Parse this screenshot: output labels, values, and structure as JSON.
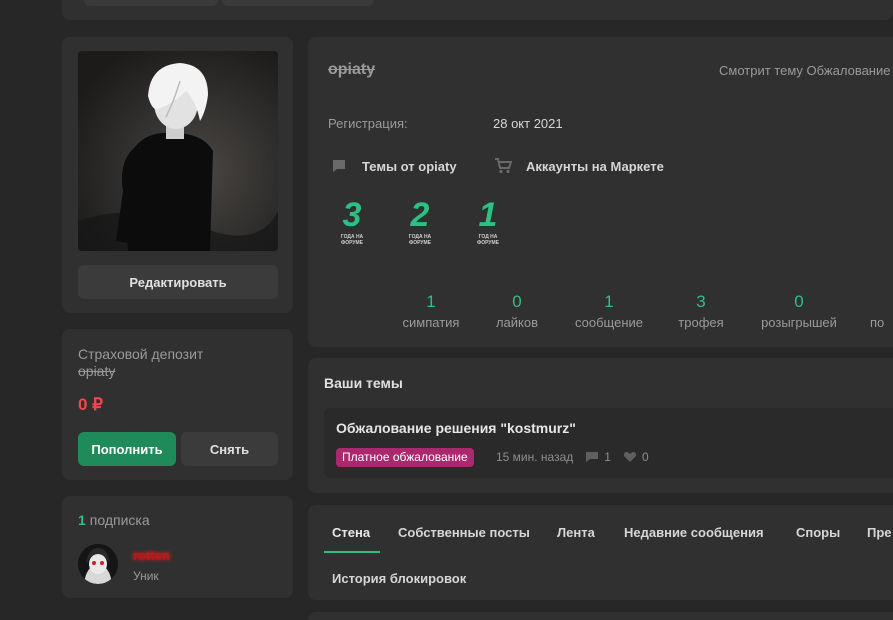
{
  "profile": {
    "username": "opiaty",
    "viewing_status": "Смотрит тему Обжалование",
    "registration_label": "Регистрация:",
    "registration_date": "28 окт 2021",
    "edit_button": "Редактировать",
    "links": [
      {
        "label": "Темы от opiaty",
        "icon": "chat-bubble-icon"
      },
      {
        "label": "Аккаунты на Маркете",
        "icon": "cart-icon"
      }
    ],
    "trophies": [
      {
        "number": "3",
        "caption_line1": "ГОДА НА",
        "caption_line2": "ФОРУМЕ"
      },
      {
        "number": "2",
        "caption_line1": "ГОДА НА",
        "caption_line2": "ФОРУМЕ"
      },
      {
        "number": "1",
        "caption_line1": "ГОД НА",
        "caption_line2": "ФОРУМЕ"
      }
    ],
    "stats": [
      {
        "value": "1",
        "label": "симпатия"
      },
      {
        "value": "0",
        "label": "лайков"
      },
      {
        "value": "1",
        "label": "сообщение"
      },
      {
        "value": "3",
        "label": "трофея"
      },
      {
        "value": "0",
        "label": "розыгрышей"
      },
      {
        "value": "",
        "label": "по"
      }
    ]
  },
  "deposit": {
    "title": "Страховой депозит",
    "name": "opiaty",
    "amount": "0 ₽",
    "topup_button": "Пополнить",
    "withdraw_button": "Снять"
  },
  "subscriptions": {
    "count": "1",
    "label": "подписка",
    "items": [
      {
        "name": "rotten",
        "role": "Уник"
      }
    ]
  },
  "topics": {
    "title": "Ваши темы",
    "items": [
      {
        "title": "Обжалование решения \"kostmurz\"",
        "badge": "Платное обжалование",
        "time": "15 мин. назад",
        "replies": "1",
        "likes": "0"
      }
    ]
  },
  "tabs": {
    "row1": [
      "Стена",
      "Собственные посты",
      "Лента",
      "Недавние сообщения",
      "Споры",
      "Пре"
    ],
    "row2": [
      "История блокировок"
    ],
    "active": "Стена"
  },
  "colors": {
    "accent_green": "#2fbf84",
    "primary_button": "#1f8a5a",
    "danger_red": "#f0494a",
    "badge_magenta": "#a9286e",
    "background": "#272727",
    "panel": "#303030"
  }
}
